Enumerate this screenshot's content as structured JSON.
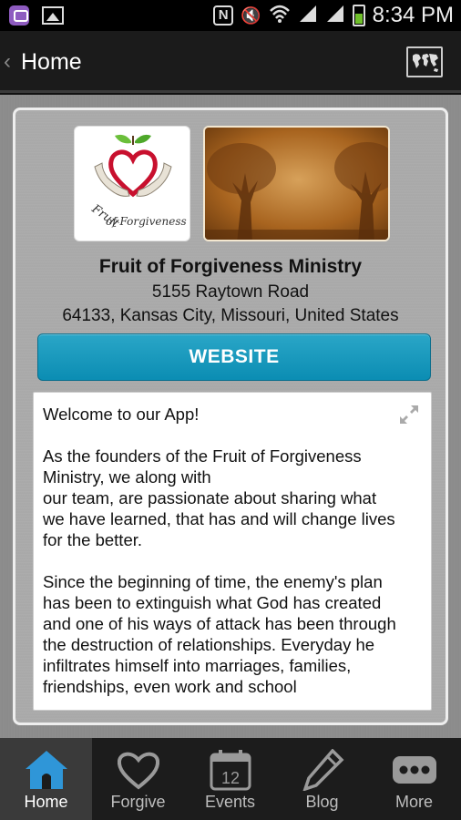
{
  "status_bar": {
    "time": "8:34 PM",
    "nfc_label": "N"
  },
  "action_bar": {
    "title": "Home"
  },
  "ministry": {
    "name": "Fruit of Forgiveness Ministry",
    "address_line1": "5155 Raytown Road",
    "address_line2": "64133, Kansas City, Missouri, United States",
    "website_label": "WEBSITE"
  },
  "welcome": {
    "line_welcome": "Welcome to our App!",
    "para1": [
      "As the founders of the Fruit of Forgiveness",
      "Ministry, we along with",
      "our team, are passionate about sharing what",
      "we have learned, that has and will change lives",
      "for the better."
    ],
    "para2": [
      "Since the beginning of time, the enemy's plan",
      "has been to extinguish what God has created",
      "and one of his ways of attack has been through",
      "the destruction of relationships. Everyday he",
      "infiltrates himself into marriages, families,",
      "friendships, even work and school"
    ]
  },
  "nav": {
    "items": [
      {
        "label": "Home",
        "icon": "house-icon",
        "active": true
      },
      {
        "label": "Forgive",
        "icon": "heart-icon",
        "active": false
      },
      {
        "label": "Events",
        "icon": "calendar-icon",
        "active": false,
        "badge": "12"
      },
      {
        "label": "Blog",
        "icon": "pencil-icon",
        "active": false
      },
      {
        "label": "More",
        "icon": "more-icon",
        "active": false
      }
    ]
  },
  "colors": {
    "accent": "#0b8db3",
    "nav_active": "#2f96d8"
  }
}
